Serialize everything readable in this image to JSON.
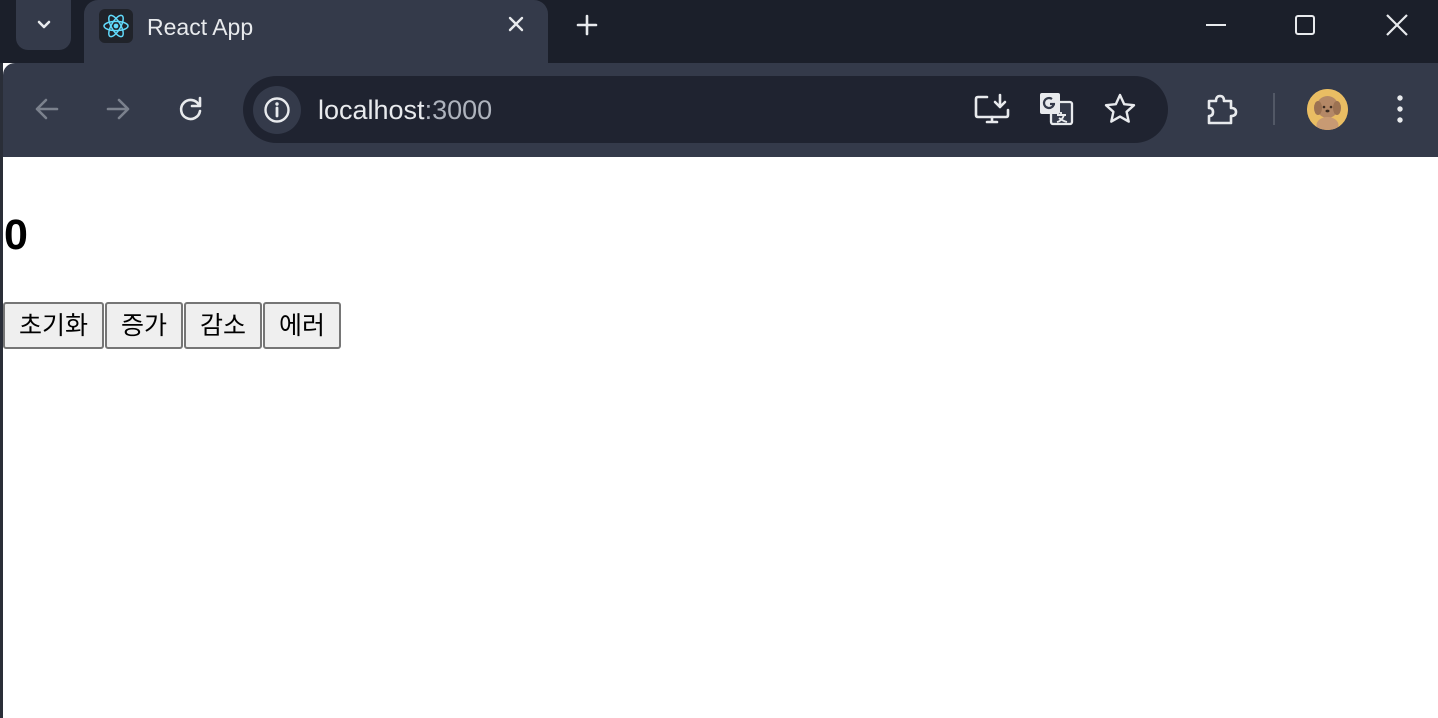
{
  "tab": {
    "title": "React App"
  },
  "address_bar": {
    "host": "localhost",
    "port": ":3000"
  },
  "page": {
    "count": "0",
    "buttons": {
      "reset": "초기화",
      "increase": "증가",
      "decrease": "감소",
      "error": "에러"
    }
  },
  "colors": {
    "tabstrip": "#1b1f2a",
    "toolbar": "#343a4a",
    "omnibox": "#1f2330",
    "button_bg": "#efefef"
  }
}
